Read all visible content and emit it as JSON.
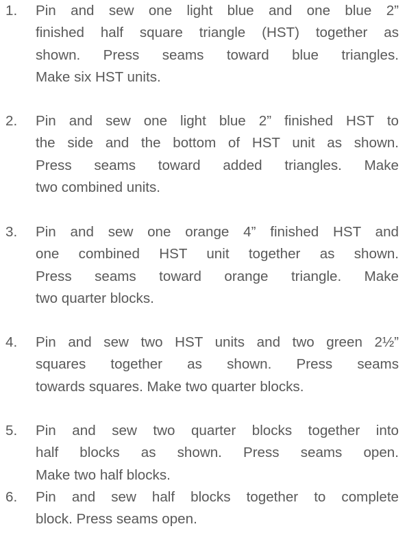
{
  "steps": [
    {
      "number": "1.",
      "lines": [
        "Pin and sew one light blue and one blue 2”",
        "finished half square triangle (HST) together as",
        "shown.  Press seams toward blue triangles.",
        "Make six HST units."
      ]
    },
    {
      "number": "2.",
      "lines": [
        "Pin and sew one light blue 2” finished HST to",
        "the side and the bottom of HST unit as shown.",
        "Press seams toward added triangles.  Make",
        "two combined units."
      ]
    },
    {
      "number": "3.",
      "lines": [
        "Pin and sew one orange 4” finished HST and",
        "one combined HST unit together as shown.",
        "Press seams toward orange triangle. Make",
        "two quarter blocks."
      ]
    },
    {
      "number": "4.",
      "lines": [
        "Pin and sew two HST units and two green 2½”",
        "squares together as shown.  Press seams",
        "towards squares. Make two quarter blocks."
      ]
    },
    {
      "number": "5.",
      "lines": [
        "Pin and sew two quarter blocks together into",
        "half blocks as shown.  Press seams open.",
        "Make two half blocks."
      ]
    },
    {
      "number": "6.",
      "lines": [
        "Pin and sew half blocks together to complete",
        "block. Press seams open."
      ]
    }
  ]
}
